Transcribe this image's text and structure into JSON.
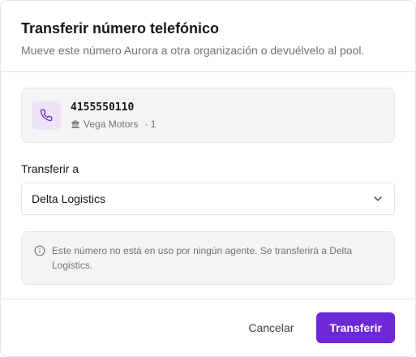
{
  "dialog": {
    "title": "Transferir número telefónico",
    "subtitle": "Mueve este número Aurora a otra organización o devuélvelo al pool."
  },
  "number_card": {
    "number": "4155550110",
    "organization": "Vega Motors",
    "count": "· 1",
    "icon": "phone-icon",
    "org_icon": "building-icon"
  },
  "transfer": {
    "label": "Transferir a",
    "selected": "Delta Logistics",
    "chevron_icon": "chevron-down-icon"
  },
  "notice": {
    "icon": "info-icon",
    "text": "Este número no está en uso por ningún agente. Se transferirá a Delta Logistics."
  },
  "footer": {
    "cancel_label": "Cancelar",
    "submit_label": "Transferir"
  },
  "colors": {
    "accent": "#6d28d9",
    "phone_badge_bg": "#ede5f7",
    "muted_text": "#71717a",
    "card_bg": "#f4f4f5",
    "border": "#e4e4e7"
  }
}
